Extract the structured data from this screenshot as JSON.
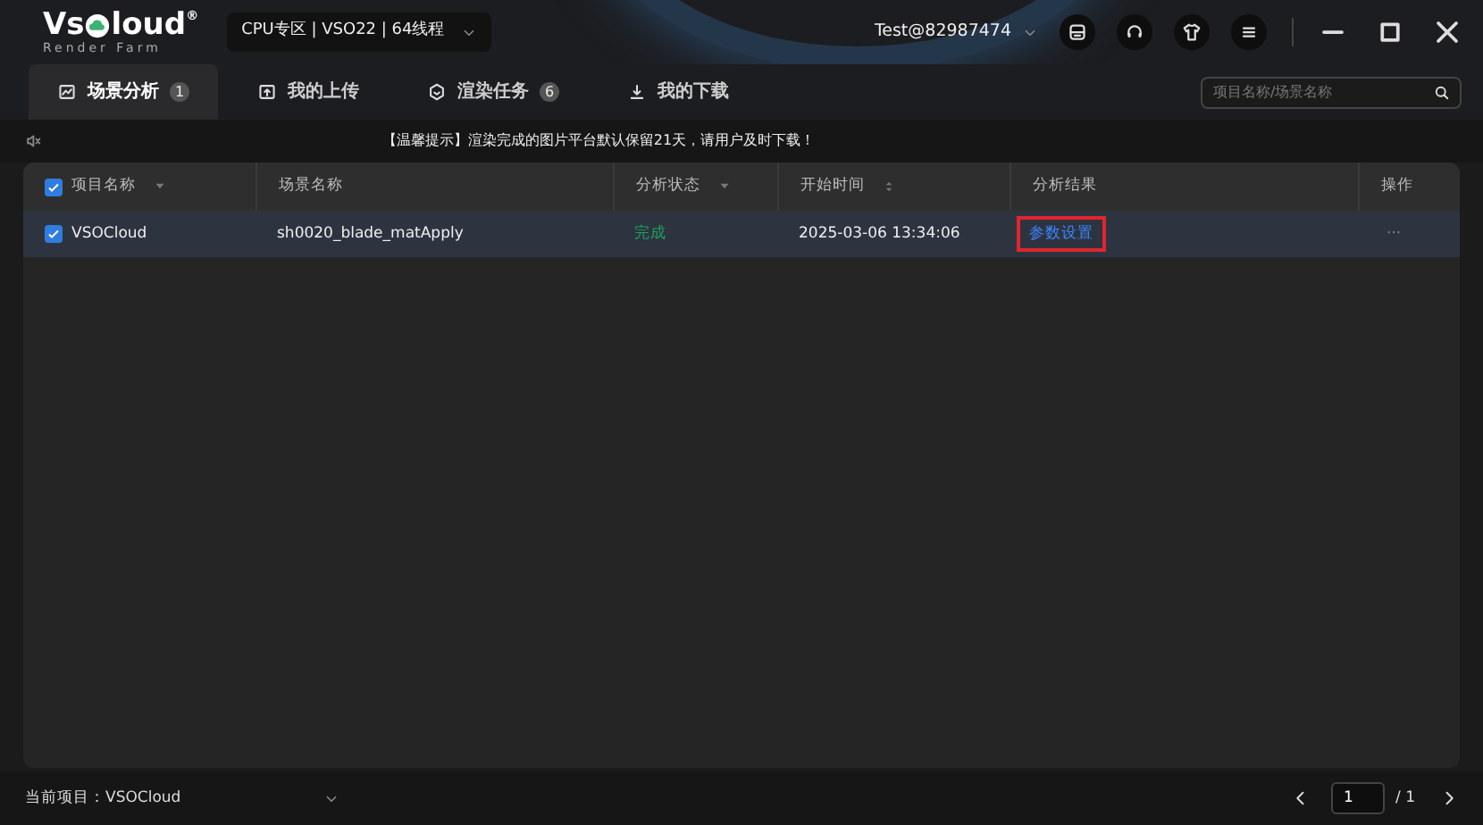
{
  "logo": {
    "text_before": "Vs",
    "text_after": "loud",
    "mark": "®",
    "tagline": "Render Farm"
  },
  "zone_select": {
    "value": "CPU专区 | VSO22 | 64线程"
  },
  "user": {
    "account": "Test@82987474"
  },
  "header_buttons": [
    {
      "kind": "printer"
    },
    {
      "kind": "headset"
    },
    {
      "kind": "shirt"
    },
    {
      "kind": "menu"
    }
  ],
  "window_controls": [
    {
      "kind": "minimize"
    },
    {
      "kind": "maximize"
    },
    {
      "kind": "close"
    }
  ],
  "tabs": [
    {
      "label": "场景分析",
      "badge": "1",
      "kind": "chart",
      "selected": true
    },
    {
      "label": "我的上传",
      "kind": "upload",
      "selected": false
    },
    {
      "label": "渲染任务",
      "badge": "6",
      "kind": "hexagon",
      "selected": false
    },
    {
      "label": "我的下载",
      "kind": "download",
      "selected": false
    }
  ],
  "search": {
    "placeholder": "项目名称/场景名称"
  },
  "notice": {
    "text": "【温馨提示】渲染完成的图片平台默认保留21天，请用户及时下载！"
  },
  "table": {
    "select_all_checked": true,
    "columns": [
      {
        "label": "项目名称",
        "kind": "filter"
      },
      {
        "label": "场景名称",
        "kind": "plain"
      },
      {
        "label": "分析状态",
        "kind": "filter"
      },
      {
        "label": "开始时间",
        "kind": "sort"
      },
      {
        "label": "分析结果",
        "kind": "plain"
      },
      {
        "label": "操作",
        "kind": "plain"
      }
    ],
    "rows": [
      {
        "checked": true,
        "project": "VSOCloud",
        "scene": "sh0020_blade_matApply",
        "status": "完成",
        "color": "#1fa05a",
        "start_time": "2025-03-06 13:34:06",
        "result": "参数设置",
        "result_highlighted": true,
        "action": "···"
      }
    ]
  },
  "footer": {
    "label": "当前项目：",
    "project": "VSOCloud",
    "page": "1",
    "total": "/ 1"
  }
}
